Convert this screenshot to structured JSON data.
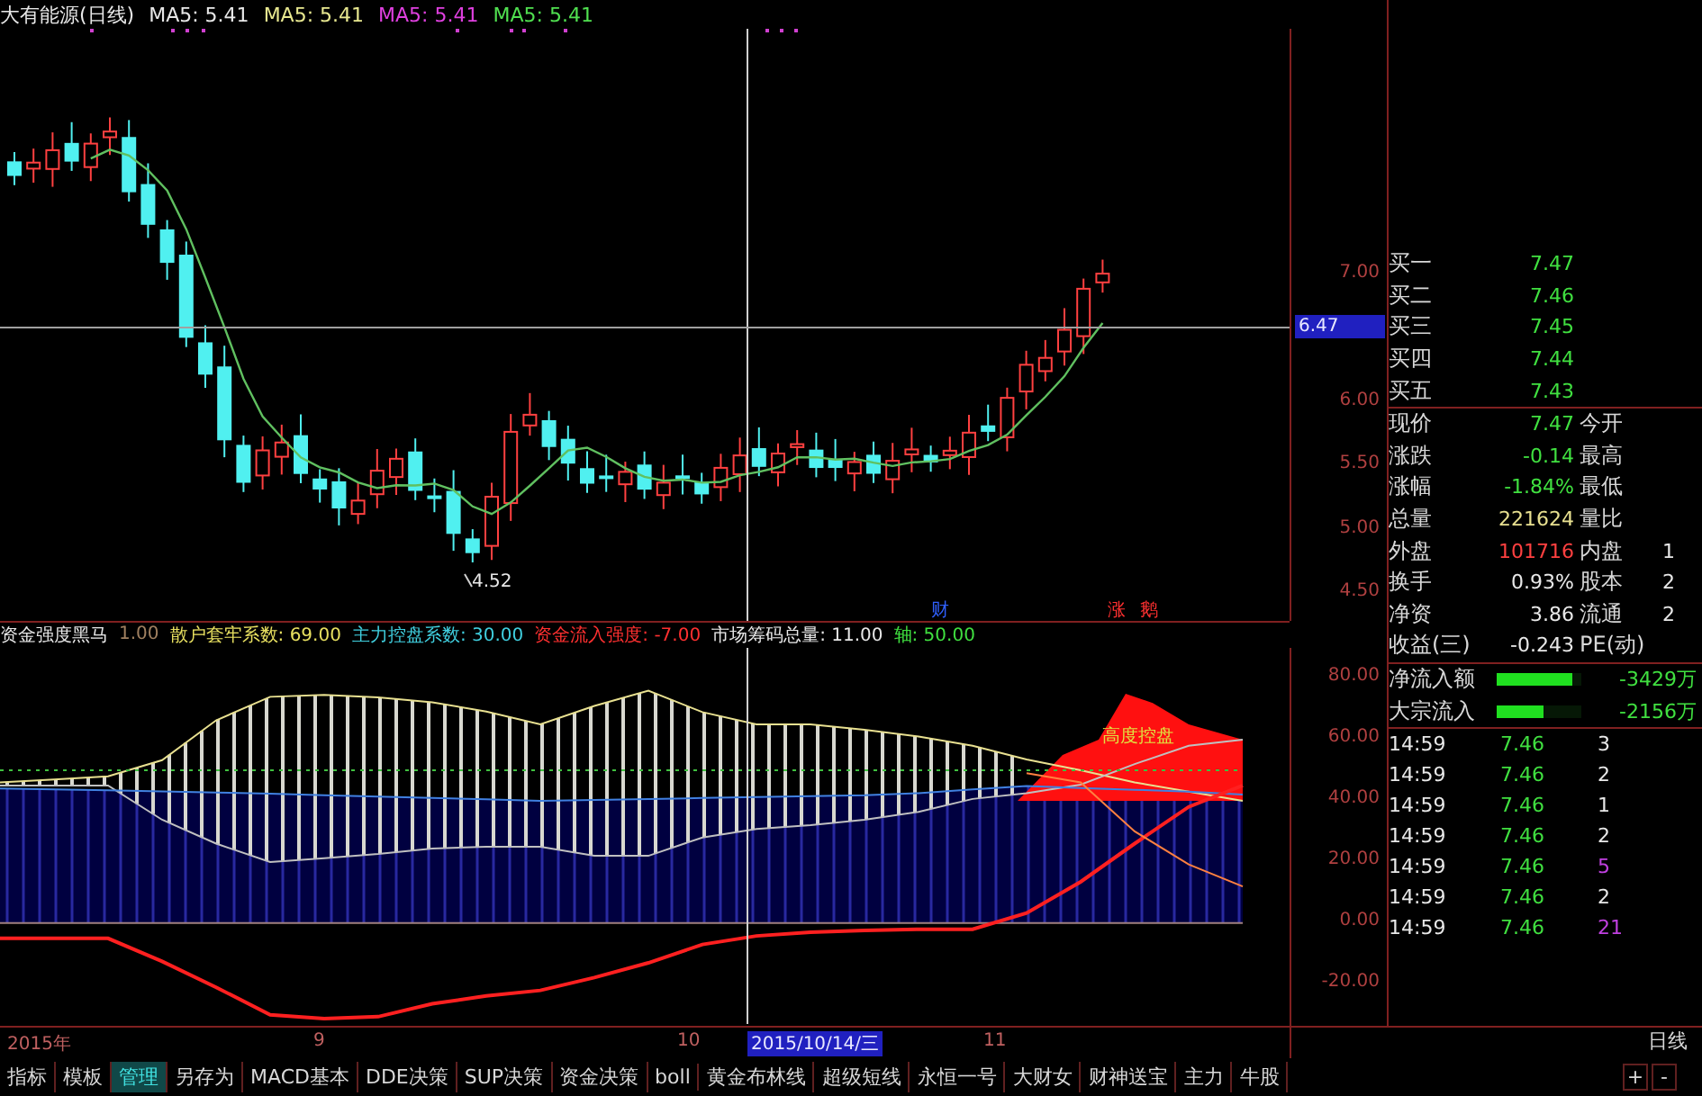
{
  "title": {
    "stock": "大有能源(日线)",
    "ma": [
      {
        "label": "MA5: 5.41",
        "color": "#e8e8e8"
      },
      {
        "label": "MA5: 5.41",
        "color": "#e8e890"
      },
      {
        "label": "MA5: 5.41",
        "color": "#e040e0"
      },
      {
        "label": "MA5: 5.41",
        "color": "#50e050"
      }
    ]
  },
  "price_axis": {
    "ticks": [
      "7.00",
      "6.00",
      "5.50",
      "5.00",
      "4.50"
    ],
    "crosshair": "6.47"
  },
  "low_label": "4.52",
  "event_marks": [
    {
      "text": "财",
      "color": "#3060ff"
    },
    {
      "text": "涨",
      "color": "#ff3030"
    },
    {
      "text": "鹅",
      "color": "#ff3030"
    }
  ],
  "indicator": {
    "name": "资金强度黑马",
    "params": [
      {
        "text": "1.00",
        "color": "#a08060"
      },
      {
        "text": "散户套牢系数: 69.00",
        "color": "#e8e060"
      },
      {
        "text": "主力控盘系数: 30.00",
        "color": "#40d0e0"
      },
      {
        "text": "资金流入强度: -7.00",
        "color": "#ff3030"
      },
      {
        "text": "市场筹码总量: 11.00",
        "color": "#e8e8e8"
      },
      {
        "text": "轴: 50.00",
        "color": "#40e040"
      }
    ],
    "area_label": "高度控盘",
    "chart_data": {
      "type": "line",
      "ylim": [
        -33,
        90
      ],
      "yticks": [
        {
          "value": 80,
          "label": "80.00"
        },
        {
          "value": 60,
          "label": "60.00"
        },
        {
          "value": 40,
          "label": "40.00"
        },
        {
          "value": 20,
          "label": "20.00"
        },
        {
          "value": 0,
          "label": "0.00"
        },
        {
          "value": -20,
          "label": "-20.00"
        }
      ],
      "series": [
        {
          "color": "#e8e090",
          "values": [
            46,
            47,
            48,
            53.3,
            66.3,
            74,
            74.6,
            73.8,
            72.2,
            69.2,
            65,
            71,
            76,
            69,
            65,
            65,
            63.2,
            61,
            58,
            53.5,
            50,
            46,
            43,
            40
          ]
        },
        {
          "color": "#c0c0c0",
          "values": [
            45,
            45,
            45,
            33.8,
            26,
            20,
            21.2,
            22.6,
            24.4,
            25,
            25,
            22,
            22,
            28,
            30.8,
            32,
            33.8,
            36.4,
            40.6,
            42.5,
            45.3,
            52,
            58,
            60
          ]
        },
        {
          "color": "#4080e0",
          "values": [
            44,
            43.7,
            43.4,
            43.1,
            42.7,
            42.3,
            41.8,
            41.4,
            40.9,
            40.5,
            40,
            40.3,
            40.6,
            40.9,
            41.2,
            41.5,
            41.8,
            42.5,
            43.7,
            44.8,
            44.2,
            43.6,
            43,
            42
          ]
        },
        {
          "color": "#ff2020",
          "values": [
            -5,
            -5,
            -5,
            -12.5,
            -21,
            -30,
            -31.2,
            -30.6,
            -26.4,
            -23.8,
            -22,
            -17.8,
            -13,
            -7,
            -4.2,
            -3,
            -2.4,
            -2,
            -2,
            3.3,
            13.5,
            26,
            38,
            45
          ]
        },
        {
          "color": "#40c040",
          "line_style": "dotted",
          "values": [
            50,
            50,
            50,
            50,
            50,
            50,
            50,
            50,
            50,
            50,
            50,
            50,
            50,
            50,
            50,
            50,
            50,
            50,
            50,
            50,
            50,
            50,
            50,
            50
          ]
        },
        {
          "color": "#ff8040",
          "values": [
            null,
            null,
            null,
            null,
            null,
            null,
            null,
            null,
            null,
            null,
            null,
            null,
            null,
            null,
            null,
            null,
            null,
            null,
            null,
            49,
            46,
            30,
            19.2,
            12
          ]
        }
      ]
    }
  },
  "date_axis": {
    "labels": [
      {
        "text": "2015年",
        "selected": false
      },
      {
        "text": "9",
        "selected": false
      },
      {
        "text": "10",
        "selected": false
      },
      {
        "text": "2015/10/14/三",
        "selected": true
      },
      {
        "text": "11",
        "selected": false
      }
    ],
    "period": "日线"
  },
  "quotes": {
    "bids": [
      {
        "label": "买一",
        "price": "7.47"
      },
      {
        "label": "买二",
        "price": "7.46"
      },
      {
        "label": "买三",
        "price": "7.45"
      },
      {
        "label": "买四",
        "price": "7.44"
      },
      {
        "label": "买五",
        "price": "7.43"
      }
    ],
    "stats": [
      {
        "label": "现价",
        "value": "7.47",
        "color": "#40e040",
        "label2": "今开"
      },
      {
        "label": "涨跌",
        "value": "-0.14",
        "color": "#40e040",
        "label2": "最高"
      },
      {
        "label": "涨幅",
        "value": "-1.84%",
        "color": "#40e040",
        "label2": "最低"
      },
      {
        "label": "总量",
        "value": "221624",
        "color": "#e8e090",
        "label2": "量比"
      },
      {
        "label": "外盘",
        "value": "101716",
        "color": "#ff4040",
        "label2": "内盘",
        "value2": "1"
      },
      {
        "label": "换手",
        "value": "0.93%",
        "color": "#e8e8e8",
        "label2": "股本",
        "value2": "2"
      },
      {
        "label": "净资",
        "value": "3.86",
        "color": "#e8e8e8",
        "label2": "流通",
        "value2": "2"
      },
      {
        "label": "收益(三)",
        "value": "-0.243",
        "color": "#e8e8e8",
        "label2": "PE(动)"
      }
    ],
    "flows": [
      {
        "label": "净流入额",
        "level": 0.9,
        "value": "-3429万"
      },
      {
        "label": "大宗流入",
        "level": 0.55,
        "value": "-2156万"
      }
    ],
    "trades": [
      {
        "time": "14:59",
        "price": "7.46",
        "volume": "3",
        "color": "#e8e8e8"
      },
      {
        "time": "14:59",
        "price": "7.46",
        "volume": "2",
        "color": "#e8e8e8"
      },
      {
        "time": "14:59",
        "price": "7.46",
        "volume": "1",
        "color": "#e8e8e8"
      },
      {
        "time": "14:59",
        "price": "7.46",
        "volume": "2",
        "color": "#e8e8e8"
      },
      {
        "time": "14:59",
        "price": "7.46",
        "volume": "5",
        "color": "#c040e0"
      },
      {
        "time": "14:59",
        "price": "7.46",
        "volume": "2",
        "color": "#e8e8e8"
      },
      {
        "time": "14:59",
        "price": "7.46",
        "volume": "21",
        "color": "#c040e0"
      }
    ]
  },
  "toolbar": {
    "tabs": [
      {
        "label": "指标",
        "selected": false
      },
      {
        "label": "模板",
        "selected": false
      },
      {
        "label": "管理",
        "selected": true
      },
      {
        "label": "另存为",
        "selected": false
      },
      {
        "label": "MACD基本",
        "selected": false
      },
      {
        "label": "DDE决策",
        "selected": false
      },
      {
        "label": "SUP决策",
        "selected": false
      },
      {
        "label": "资金决策",
        "selected": false
      },
      {
        "label": "boll",
        "selected": false
      },
      {
        "label": "黄金布林线",
        "selected": false
      },
      {
        "label": "超级短线",
        "selected": false
      },
      {
        "label": "永恒一号",
        "selected": false
      },
      {
        "label": "大财女",
        "selected": false
      },
      {
        "label": "财神送宝",
        "selected": false
      },
      {
        "label": "主力",
        "selected": false
      },
      {
        "label": "牛股",
        "selected": false
      }
    ],
    "zoom_in": "+",
    "zoom_out": "-"
  }
}
